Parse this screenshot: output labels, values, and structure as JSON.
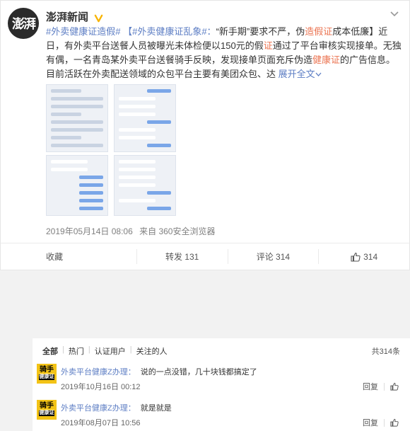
{
  "post": {
    "author": "澎湃新闻",
    "avatar_text": "澎湃",
    "text_parts": {
      "tag1": "#外卖健康证造假#",
      "tag2": "【#外卖健康证乱象#：",
      "t1": "“新手期”要求不严，伪",
      "h1": "造假证",
      "t2": "成本低廉】近日，有外卖平台送餐人员被曝光未体检便以150元的假",
      "h2": "证",
      "t3": "通过了平台审核实现接单。无独有偶，一名青岛某外卖平台送餐骑手反映，发现接单页面充斥伪造",
      "h3": "健康证",
      "t4": "的广告信息。目前活跃在外卖配送领域的众包平台主要有美团众包、达",
      "more": "展开全文"
    },
    "timestamp": "2019年05月14日 08:06",
    "source": "来自 360安全浏览器",
    "actions": {
      "favorite": "收藏",
      "repost": "转发 131",
      "comment": "评论 314",
      "like": "314"
    }
  },
  "comments": {
    "tabs": [
      "全部",
      "热门",
      "认证用户",
      "关注的人"
    ],
    "total": "共314条",
    "items": [
      {
        "user": "外卖平台健康Z办理：",
        "text": "说的一点没错，几十块钱都搞定了",
        "time": "2019年10月16日 00:12",
        "reply": "回复"
      },
      {
        "user": "外卖平台健康Z办理：",
        "text": "就是就是",
        "time": "2019年08月07日 10:56",
        "reply": "回复"
      }
    ],
    "avatar_text": "骑手",
    "avatar_sub": "健康证"
  },
  "colors": {
    "accent": "#eb7350",
    "link": "#5d7ec4",
    "verified": "#f8b400"
  }
}
